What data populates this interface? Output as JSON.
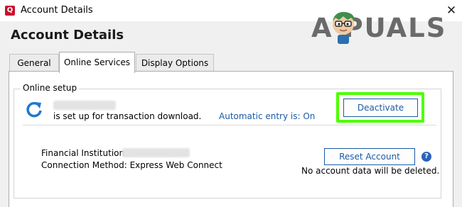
{
  "window": {
    "title": "Account Details",
    "app_icon_letter": "Q",
    "close_glyph": "✕"
  },
  "watermark": {
    "text": "A  PUALS"
  },
  "page": {
    "heading": "Account Details"
  },
  "tabs": [
    {
      "label": "General",
      "active": false
    },
    {
      "label": "Online Services",
      "active": true
    },
    {
      "label": "Display Options",
      "active": false
    }
  ],
  "online_setup": {
    "legend": "Online setup",
    "icon": "refresh-icon",
    "status_text": "is set up for transaction download.",
    "automatic_entry": "Automatic entry is: On",
    "deactivate_label": "Deactivate",
    "financial_institution_label": "Financial Institution:",
    "connection_method": "Connection Method: Express Web Connect",
    "reset_label": "Reset Account",
    "reset_note": "No account data will be deleted.",
    "help_glyph": "?"
  },
  "colors": {
    "accent": "#1a5ba6",
    "highlight": "#4cff00",
    "brand": "#c8102e"
  }
}
